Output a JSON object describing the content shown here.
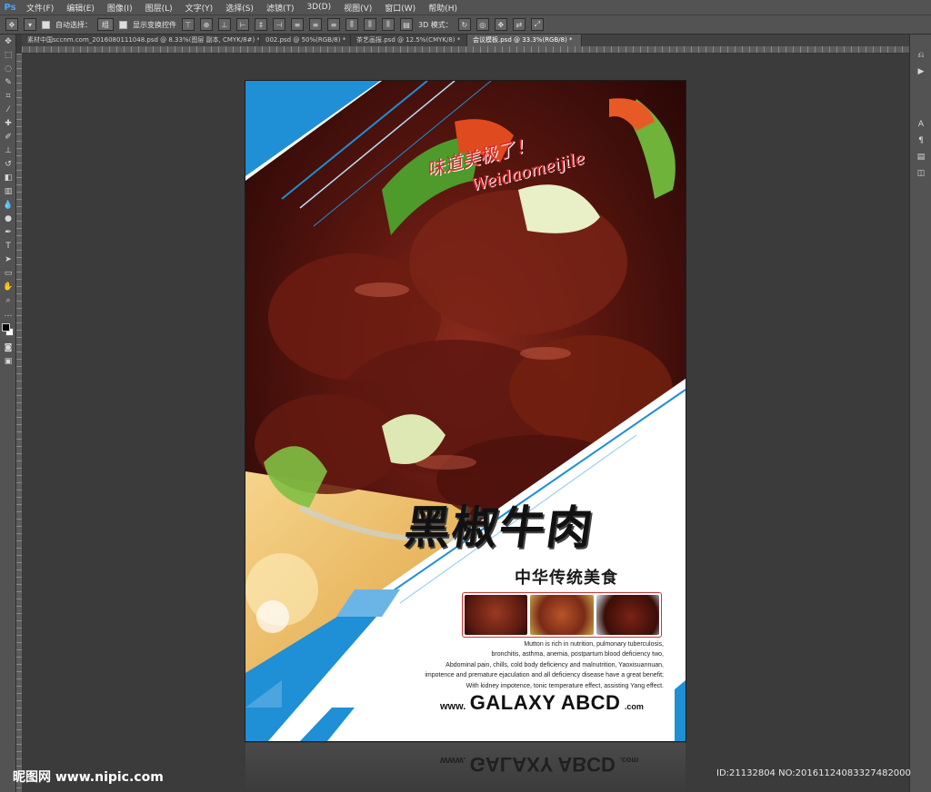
{
  "app": {
    "logo": "Ps"
  },
  "menu": [
    "文件(F)",
    "编辑(E)",
    "图像(I)",
    "图层(L)",
    "文字(Y)",
    "选择(S)",
    "滤镜(T)",
    "3D(D)",
    "视图(V)",
    "窗口(W)",
    "帮助(H)"
  ],
  "options": {
    "auto_select_label": "自动选择：",
    "auto_select_value": "组",
    "show_transform_label": "显示变换控件",
    "mode_3d_label": "3D 模式："
  },
  "tabs": [
    {
      "label": "素材中国sccnm.com_2016080111048.psd @ 8.33%(图层 副本, CMYK/8#) *",
      "active": false
    },
    {
      "label": "002.psd @ 50%(RGB/8) *",
      "active": false
    },
    {
      "label": "茶艺画报.psd @ 12.5%(CMYK/8) *",
      "active": false
    },
    {
      "label": "会议模板.psd @ 33.3%(RGB/8) *",
      "active": true
    }
  ],
  "poster": {
    "script_cn": "味道美极了！",
    "script_en": "Weidaomeijile",
    "title_cn": "黑椒牛肉",
    "subtitle_cn": "中华传统美食",
    "description": [
      "Mutton is rich in nutrition, pulmonary tuberculosis,",
      "bronchitis, asthma, anemia, postpartum blood deficiency two,",
      "Abdominal pain, chills, cold body deficiency and malnutrition, Yaoxisuannuan,",
      "impotence and premature ejaculation and all deficiency disease have a great benefit;",
      "With kidney impotence, tonic temperature effect, assisting Yang effect."
    ],
    "website_pre": "www.",
    "website_main": "GALAXY ABCD",
    "website_post": ".com"
  },
  "watermark": {
    "site": "昵图网 www.nipic.com",
    "id": "ID:21132804 NO:20161124083327482000"
  },
  "colors": {
    "accent_blue": "#1f8fd6",
    "script_red": "#d8232a"
  }
}
